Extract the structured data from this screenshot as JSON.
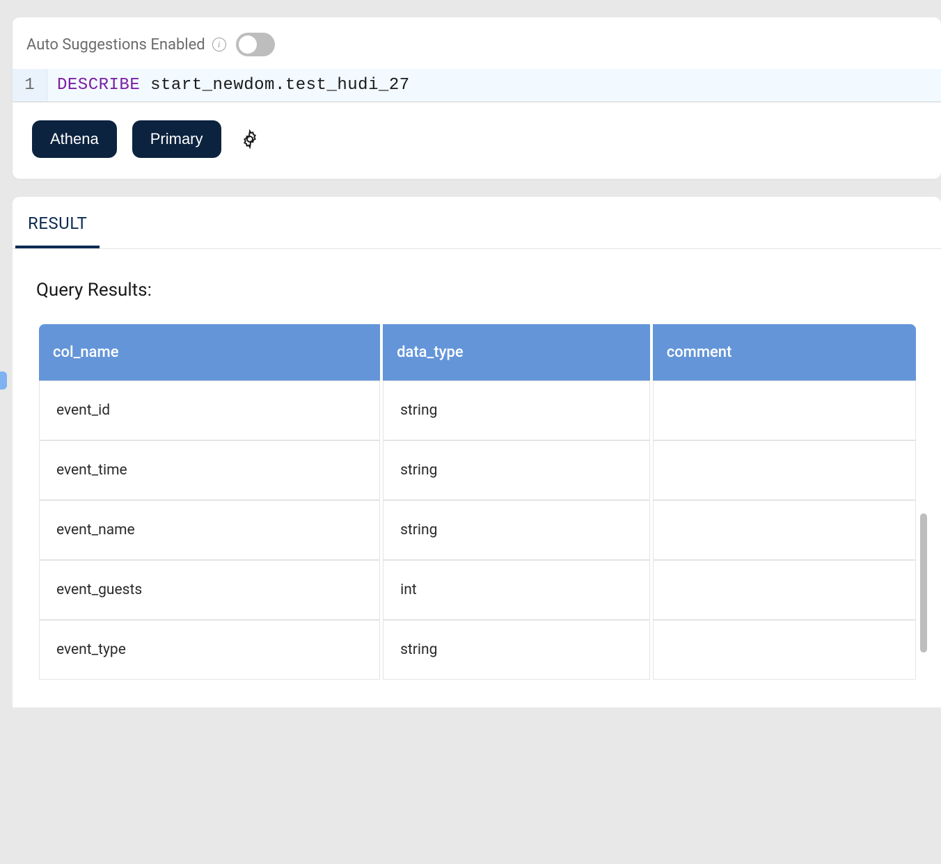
{
  "editor": {
    "suggestions_label": "Auto Suggestions Enabled",
    "line_number": "1",
    "keyword": "DESCRIBE",
    "rest": " start_newdom.test_hudi_27",
    "buttons": {
      "engine": "Athena",
      "workgroup": "Primary"
    }
  },
  "tabs": {
    "result": "RESULT"
  },
  "results": {
    "title": "Query Results:",
    "columns": [
      "col_name",
      "data_type",
      "comment"
    ],
    "rows": [
      {
        "col_name": "event_id",
        "data_type": "string",
        "comment": ""
      },
      {
        "col_name": "event_time",
        "data_type": "string",
        "comment": ""
      },
      {
        "col_name": "event_name",
        "data_type": "string",
        "comment": ""
      },
      {
        "col_name": "event_guests",
        "data_type": "int",
        "comment": ""
      },
      {
        "col_name": "event_type",
        "data_type": "string",
        "comment": ""
      }
    ]
  }
}
